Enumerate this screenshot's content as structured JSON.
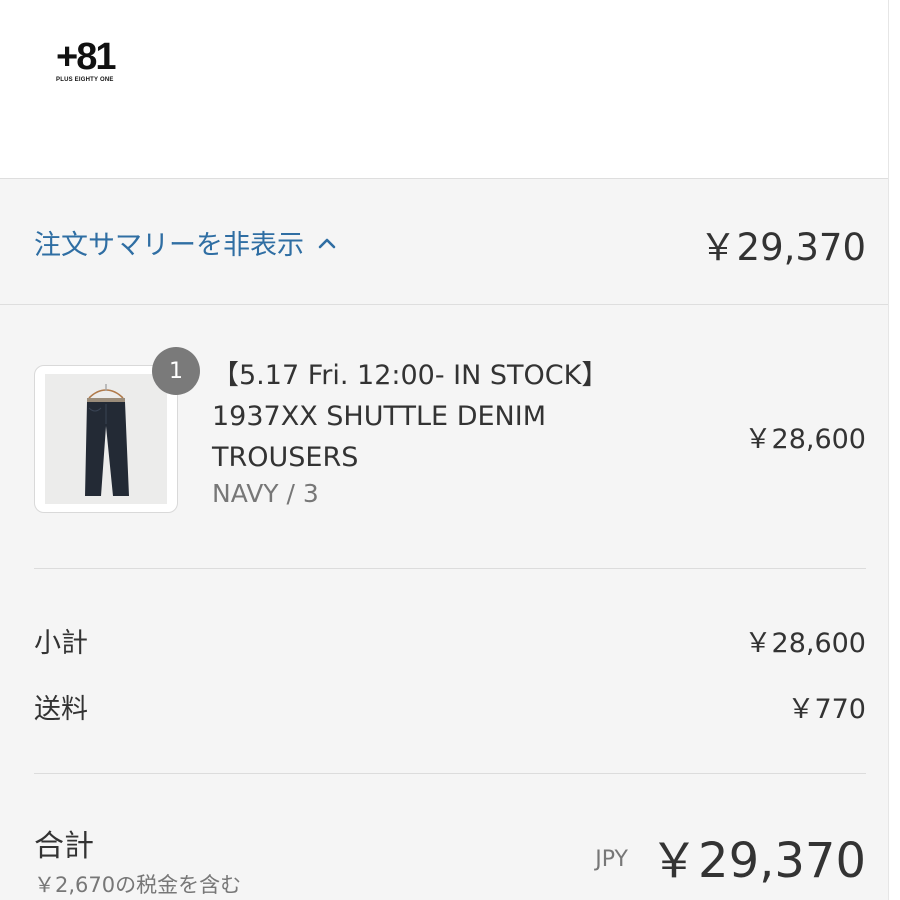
{
  "brand": {
    "logo_mark": "+81",
    "logo_sub": "PLUS EIGHTY ONE"
  },
  "summary_toggle": {
    "label": "注文サマリーを非表示",
    "total": "￥29,370"
  },
  "line_items": [
    {
      "quantity": "1",
      "title": "【5.17 Fri. 12:00- IN STOCK】1937XX SHUTTLE DENIM TROUSERS",
      "variant": "NAVY / 3",
      "price": "￥28,600",
      "image": "navy-denim-trousers"
    }
  ],
  "costs": {
    "subtotal_label": "小計",
    "subtotal_value": "￥28,600",
    "shipping_label": "送料",
    "shipping_value": "￥770"
  },
  "total": {
    "label": "合計",
    "tax_note": "￥2,670の税金を含む",
    "currency": "JPY",
    "value": "￥29,370"
  },
  "colors": {
    "link": "#2f6ea3",
    "summary_bg": "#f5f5f5",
    "badge": "#7a7a7a"
  },
  "icons": {
    "toggle": "chevron-up-icon"
  }
}
